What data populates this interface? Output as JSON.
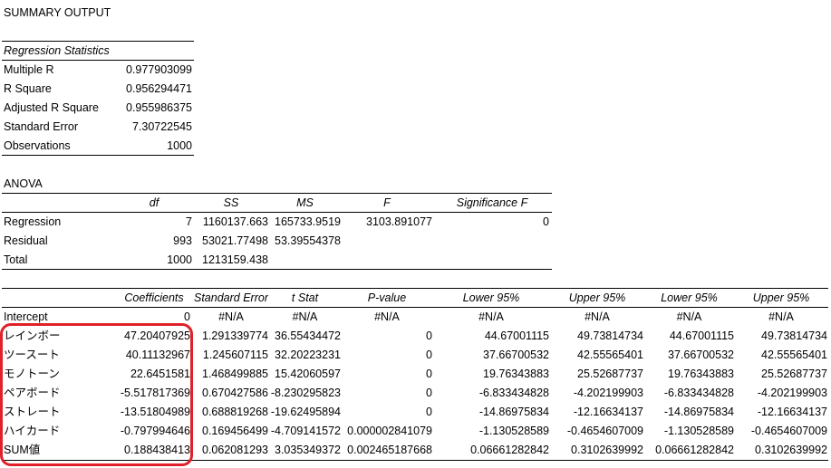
{
  "title": "SUMMARY OUTPUT",
  "regression_statistics": {
    "header": "Regression Statistics",
    "rows": [
      {
        "label": "Multiple R",
        "value": "0.977903099"
      },
      {
        "label": "R Square",
        "value": "0.956294471"
      },
      {
        "label": "Adjusted R Square",
        "value": "0.955986375"
      },
      {
        "label": "Standard Error",
        "value": "7.30722545"
      },
      {
        "label": "Observations",
        "value": "1000"
      }
    ]
  },
  "anova": {
    "title": "ANOVA",
    "headers": [
      "df",
      "SS",
      "MS",
      "F",
      "Significance F"
    ],
    "rows": [
      {
        "label": "Regression",
        "df": "7",
        "ss": "1160137.663",
        "ms": "165733.9519",
        "f": "3103.891077",
        "sigf": "0"
      },
      {
        "label": "Residual",
        "df": "993",
        "ss": "53021.77498",
        "ms": "53.39554378",
        "f": "",
        "sigf": ""
      },
      {
        "label": "Total",
        "df": "1000",
        "ss": "1213159.438",
        "ms": "",
        "f": "",
        "sigf": ""
      }
    ]
  },
  "coefficients": {
    "headers": [
      "Coefficients",
      "Standard Error",
      "t Stat",
      "P-value",
      "Lower 95%",
      "Upper 95%",
      "Lower 95%",
      "Upper 95%"
    ],
    "rows": [
      {
        "label": "Intercept",
        "v": [
          "0",
          "#N/A",
          "#N/A",
          "#N/A",
          "#N/A",
          "#N/A",
          "#N/A",
          "#N/A"
        ]
      },
      {
        "label": "レインボー",
        "v": [
          "47.20407925",
          "1.291339774",
          "36.55434472",
          "0",
          "44.67001115",
          "49.73814734",
          "44.67001115",
          "49.73814734"
        ]
      },
      {
        "label": "ツースート",
        "v": [
          "40.11132967",
          "1.245607115",
          "32.20223231",
          "0",
          "37.66700532",
          "42.55565401",
          "37.66700532",
          "42.55565401"
        ]
      },
      {
        "label": "モノトーン",
        "v": [
          "22.6451581",
          "1.468499885",
          "15.42060597",
          "0",
          "19.76343883",
          "25.52687737",
          "19.76343883",
          "25.52687737"
        ]
      },
      {
        "label": "ペアボード",
        "v": [
          "-5.517817369",
          "0.670427586",
          "-8.230295823",
          "0",
          "-6.833434828",
          "-4.202199903",
          "-6.833434828",
          "-4.202199903"
        ]
      },
      {
        "label": "ストレート",
        "v": [
          "-13.51804989",
          "0.688819268",
          "-19.62495894",
          "0",
          "-14.86975834",
          "-12.16634137",
          "-14.86975834",
          "-12.16634137"
        ]
      },
      {
        "label": "ハイカード",
        "v": [
          "-0.797994646",
          "0.169456499",
          "-4.709141572",
          "0.000002841079",
          "-1.130528589",
          "-0.4654607009",
          "-1.130528589",
          "-0.4654607009"
        ]
      },
      {
        "label": "SUM値",
        "v": [
          "0.188438413",
          "0.062081293",
          "3.035349372",
          "0.002465187668",
          "0.06661282842",
          "0.3102639992",
          "0.06661282842",
          "0.3102639992"
        ]
      }
    ]
  },
  "highlight": {
    "color": "#e0202a",
    "note_icon": "red-highlight-box"
  }
}
